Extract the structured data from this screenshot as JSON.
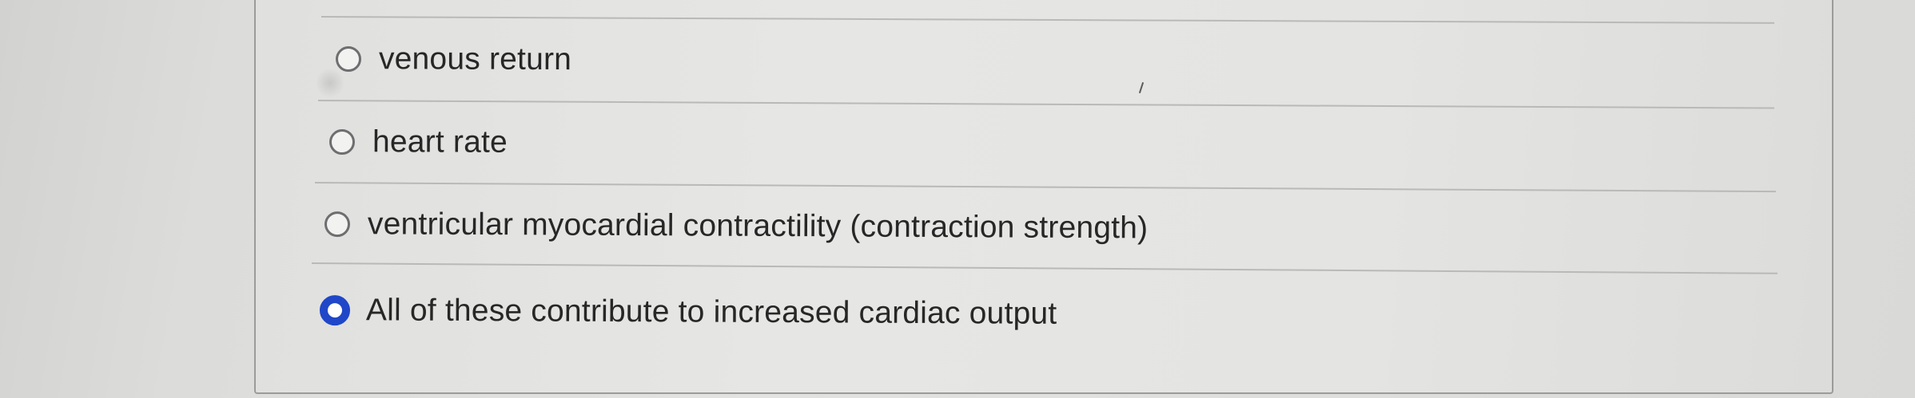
{
  "question": {
    "options": [
      {
        "label": "venous return",
        "selected": false
      },
      {
        "label": "heart rate",
        "selected": false
      },
      {
        "label": "ventricular myocardial contractility (contraction strength)",
        "selected": false
      },
      {
        "label": "All of these contribute to increased cardiac output",
        "selected": true
      }
    ]
  },
  "colors": {
    "selected_radio": "#1f47c8",
    "unselected_radio_border": "#6e6e70",
    "text": "#272727"
  }
}
